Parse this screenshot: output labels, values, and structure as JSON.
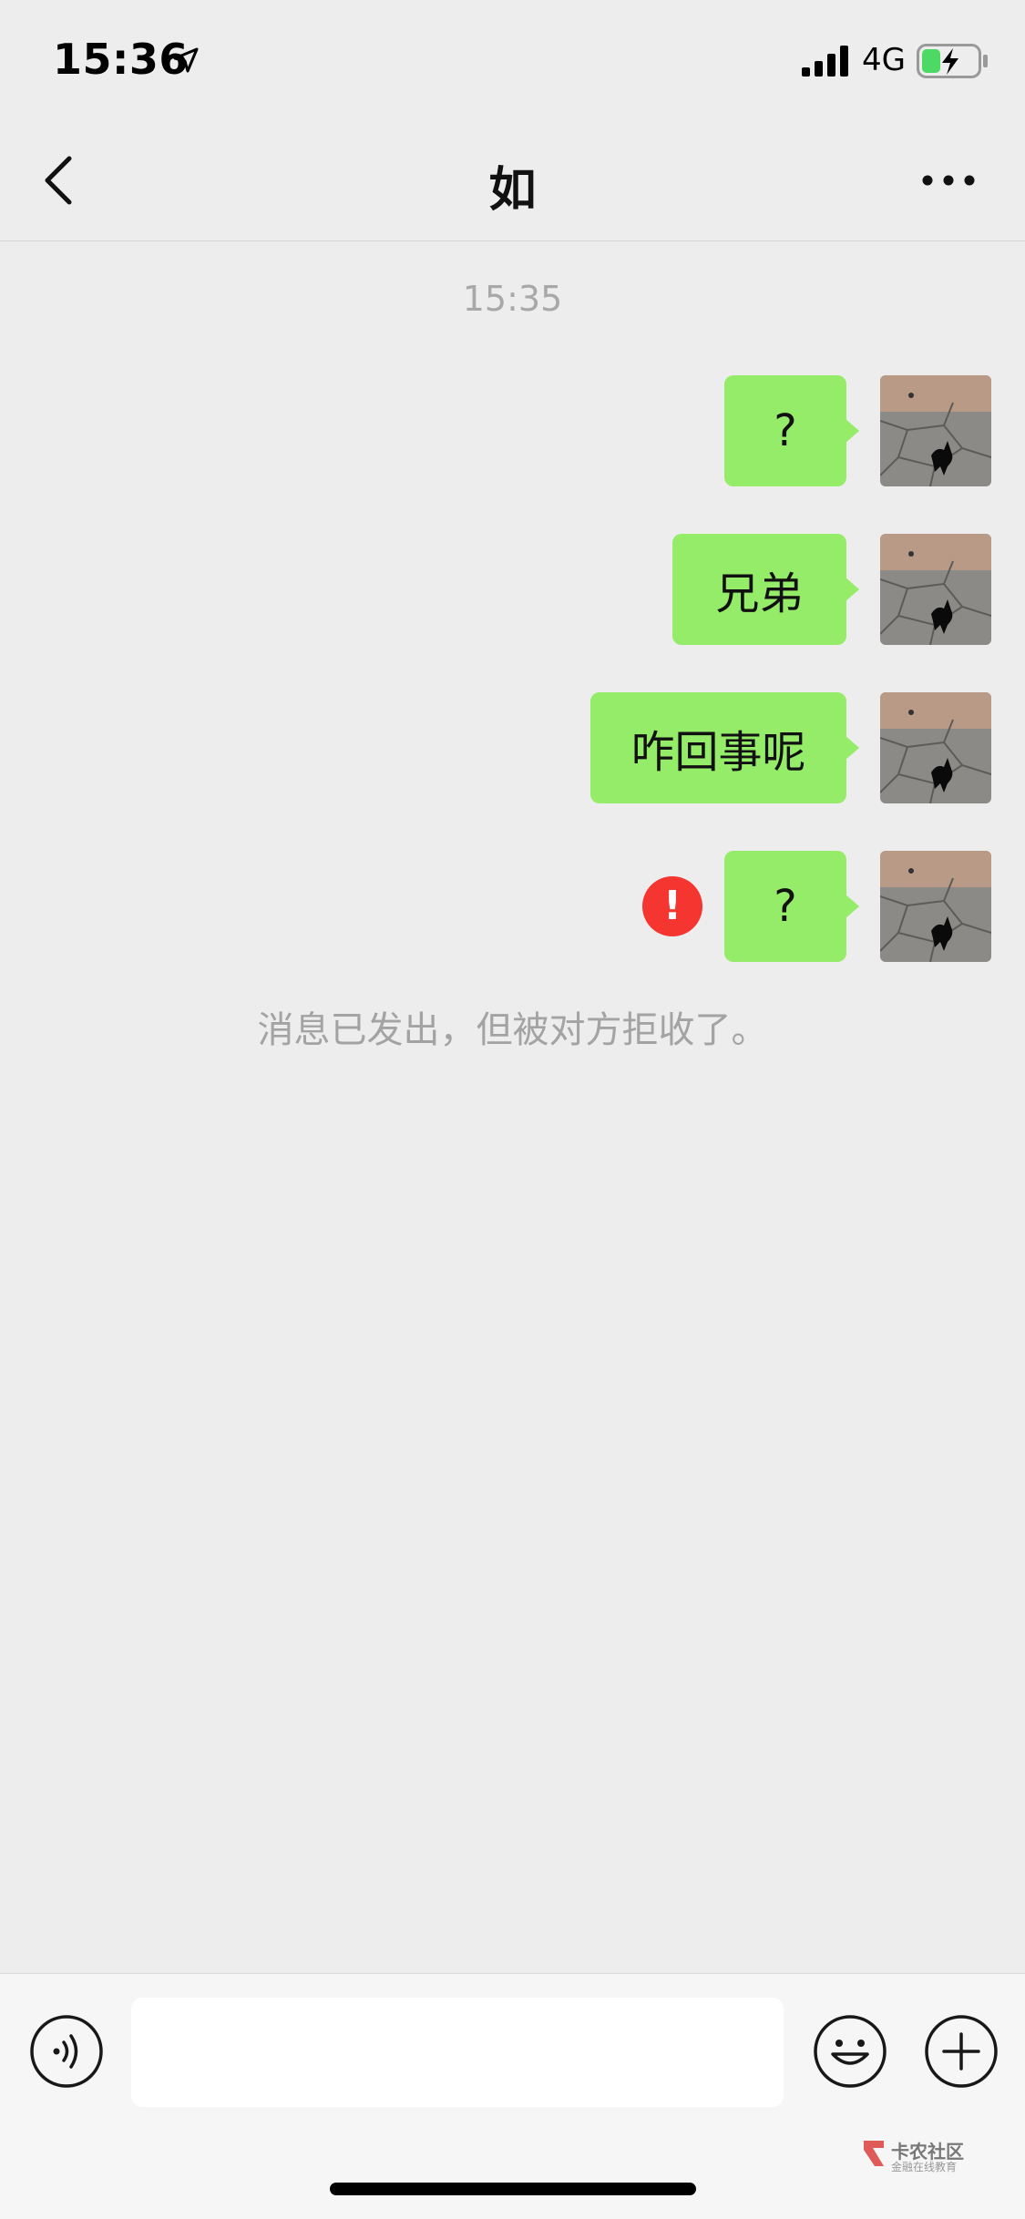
{
  "status_bar": {
    "time": "15:36",
    "network": "4G"
  },
  "nav": {
    "title": "如"
  },
  "chat": {
    "timestamp": "15:35",
    "messages": [
      {
        "text": "?",
        "failed": false
      },
      {
        "text": "兄弟",
        "failed": false
      },
      {
        "text": "咋回事呢",
        "failed": false
      },
      {
        "text": "?",
        "failed": true
      }
    ],
    "system_notice": "消息已发出，但被对方拒收了。",
    "error_mark": "!"
  },
  "input_bar": {
    "placeholder": ""
  },
  "watermark": {
    "name": "卡农社区",
    "sub": "金融在线教育"
  },
  "colors": {
    "bubble": "#95ec69",
    "error": "#f43530",
    "background": "#ededed"
  }
}
